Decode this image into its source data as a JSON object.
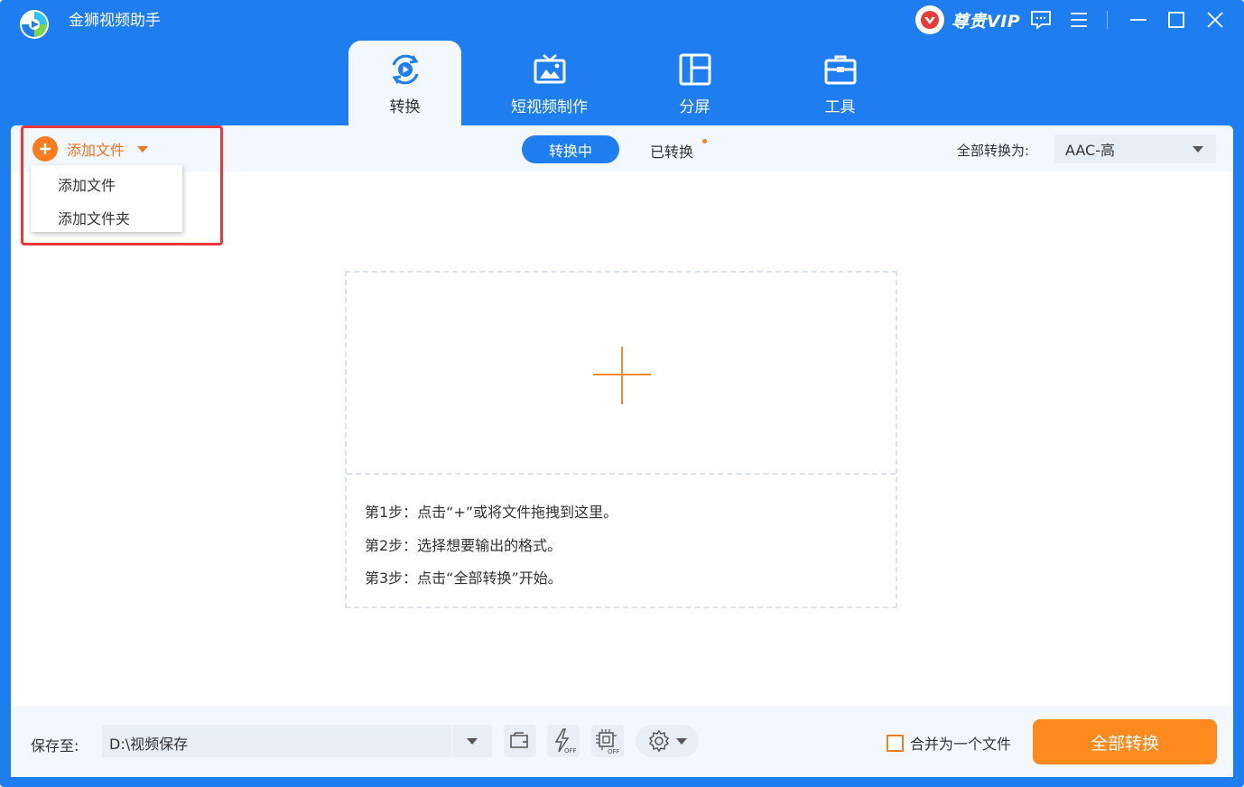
{
  "app": {
    "title": "金狮视频助手",
    "vip_label": "尊贵VIP"
  },
  "window_controls": [
    "feedback-icon",
    "menu-icon",
    "minimize-icon",
    "maximize-icon",
    "close-icon"
  ],
  "main_tabs": [
    {
      "label": "转换",
      "icon": "convert-icon",
      "active": true
    },
    {
      "label": "短视频制作",
      "icon": "tv-icon",
      "active": false
    },
    {
      "label": "分屏",
      "icon": "split-screen-icon",
      "active": false
    },
    {
      "label": "工具",
      "icon": "toolbox-icon",
      "active": false
    }
  ],
  "toolbar": {
    "add_file_label": "添加文件",
    "status_tabs": [
      {
        "label": "转换中",
        "active": true
      },
      {
        "label": "已转换",
        "active": false
      }
    ],
    "convert_all_label": "全部转换为:",
    "format_value": "AAC-高"
  },
  "add_menu": {
    "items": [
      "添加文件",
      "添加文件夹"
    ]
  },
  "drop_zone": {
    "steps": [
      "第1步：点击“+”或将文件拖拽到这里。",
      "第2步：选择想要输出的格式。",
      "第3步：点击“全部转换”开始。"
    ]
  },
  "bottom_bar": {
    "save_label": "保存至:",
    "save_path": "D:\\视频保存",
    "merge_label": "合并为一个文件",
    "merge_checked": false,
    "convert_button": "全部转换"
  },
  "colors": {
    "primary": "#1e7ef0",
    "accent": "#fd8a1e",
    "highlight": "#e8383d"
  }
}
